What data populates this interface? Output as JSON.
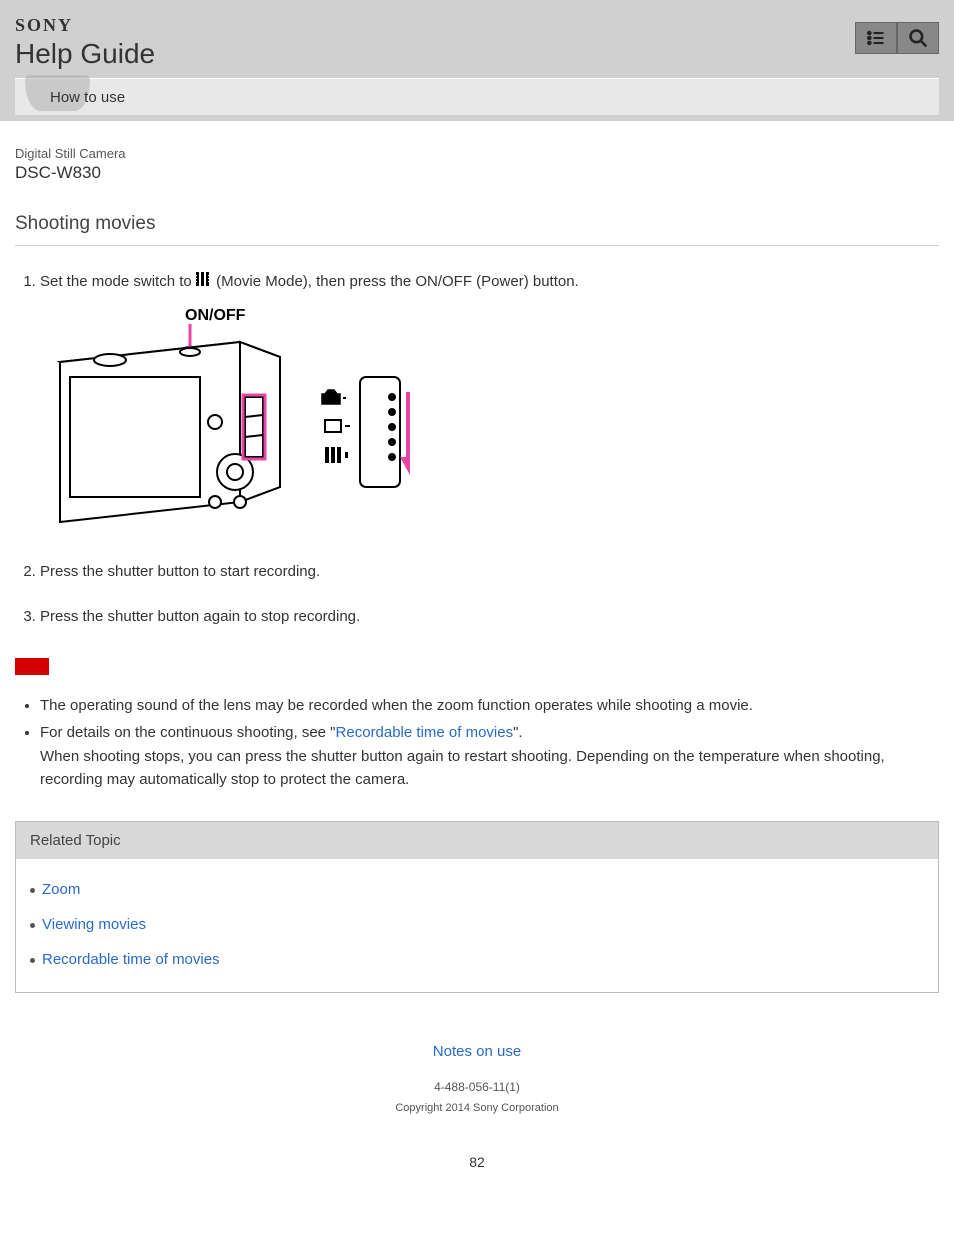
{
  "header": {
    "brand": "SONY",
    "title": "Help Guide",
    "nav_label": "How to use"
  },
  "product": {
    "category": "Digital Still Camera",
    "model": "DSC-W830"
  },
  "page": {
    "title": "Shooting movies",
    "number": "82"
  },
  "steps": {
    "s1_a": "Set the mode switch to ",
    "s1_b": " (Movie Mode), then press the ON/OFF (Power) button.",
    "s2": "Press the shutter button to start recording.",
    "s3": "Press the shutter button again to stop recording.",
    "illustration_label": "ON/OFF"
  },
  "notes": {
    "n1": "The operating sound of the lens may be recorded when the zoom function operates while shooting a movie.",
    "n2_a": "For details on the continuous shooting, see \"",
    "n2_link": "Recordable time of movies",
    "n2_b": "\".",
    "n2_c": "When shooting stops, you can press the shutter button again to restart shooting. Depending on the temperature when shooting, recording may automatically stop to protect the camera."
  },
  "related": {
    "title": "Related Topic",
    "links": [
      "Zoom",
      "Viewing movies",
      "Recordable time of movies"
    ]
  },
  "footer": {
    "notes_link": "Notes on use",
    "docnum": "4-488-056-11(1)",
    "copyright": "Copyright 2014 Sony Corporation"
  }
}
